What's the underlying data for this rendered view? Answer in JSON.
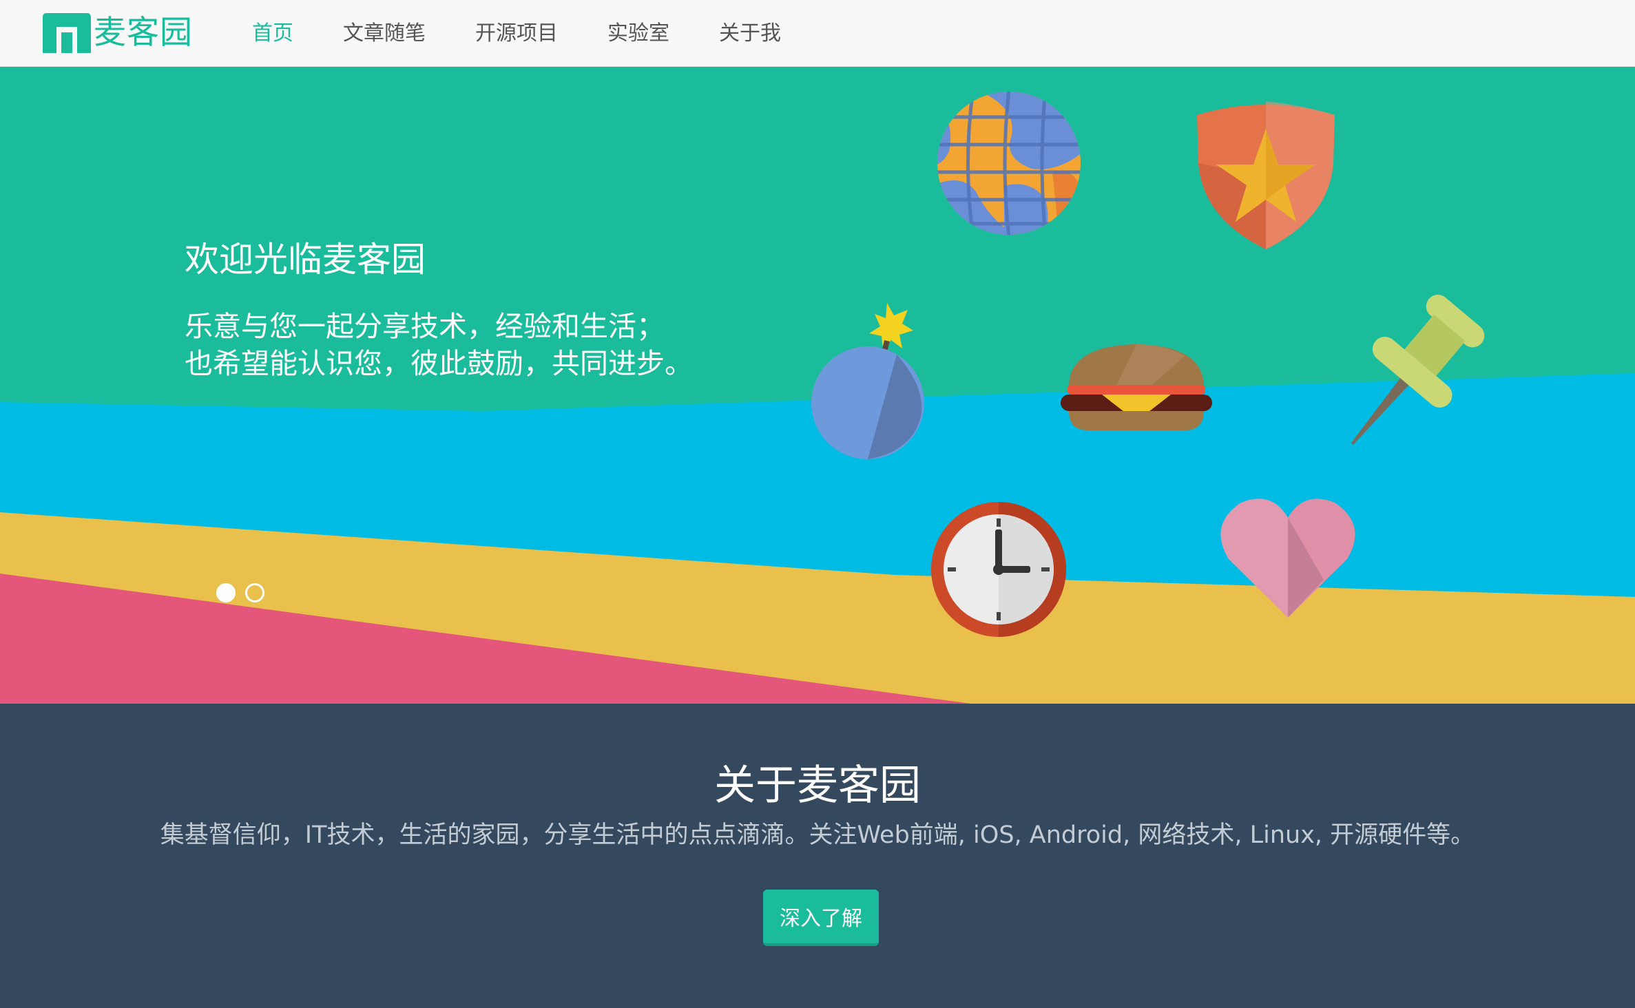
{
  "brand": {
    "name": "麦客园",
    "color": "#1abc9c"
  },
  "nav": {
    "items": [
      {
        "label": "首页",
        "active": true
      },
      {
        "label": "文章随笔",
        "active": false
      },
      {
        "label": "开源项目",
        "active": false
      },
      {
        "label": "实验室",
        "active": false
      },
      {
        "label": "关于我",
        "active": false
      }
    ]
  },
  "hero": {
    "title": "欢迎光临麦客园",
    "subtitle_line1": "乐意与您一起分享技术，经验和生活；",
    "subtitle_line2": "也希望能认识您，彼此鼓励，共同进步。",
    "slides": 2,
    "active_slide": 0,
    "colors": {
      "green": "#1abc9c",
      "blue": "#00bce4",
      "yellow": "#e9c04c",
      "pink": "#e5577a"
    },
    "icons": [
      "globe-icon",
      "shield-star-icon",
      "bomb-icon",
      "burger-icon",
      "pushpin-icon",
      "clock-icon",
      "heart-icon"
    ]
  },
  "about": {
    "title": "关于麦客园",
    "description": "集基督信仰，IT技术，生活的家园，分享生活中的点点滴滴。关注Web前端, iOS, Android, 网络技术, Linux, 开源硬件等。",
    "button_label": "深入了解",
    "background": "#34495e"
  }
}
